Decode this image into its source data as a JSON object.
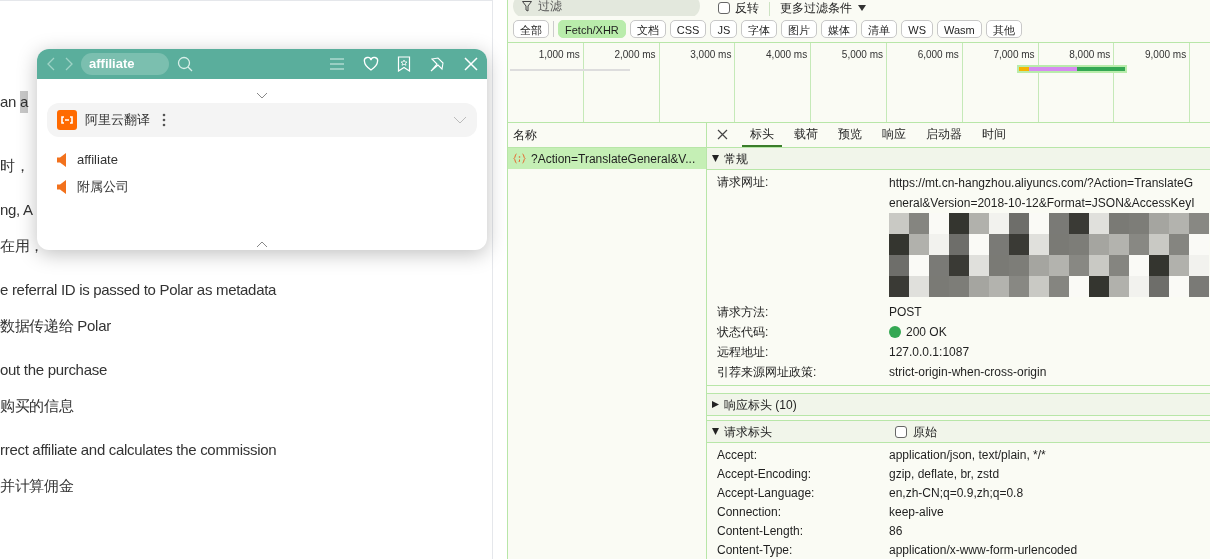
{
  "document": {
    "lines": [
      {
        "text": "an ",
        "selection": "a"
      },
      {
        "text": "时，"
      },
      {
        "text": "ng, A"
      },
      {
        "text": "在用，"
      },
      {
        "text": "e referral ID is passed to Polar as metadata"
      },
      {
        "text": "数据传递给 Polar"
      },
      {
        "text": "out the purchase"
      },
      {
        "text": "购买的信息"
      },
      {
        "text": "rrect affiliate and calculates the commission"
      },
      {
        "text": "并计算佣金"
      }
    ]
  },
  "popup": {
    "search": "affiliate",
    "engine": {
      "name": "阿里云翻译",
      "expanded": false
    },
    "results": [
      "affiliate",
      "附属公司"
    ]
  },
  "devtools": {
    "filter": {
      "placeholder": "过滤",
      "invert": {
        "label": "反转",
        "checked": false
      },
      "more": "更多过滤条件"
    },
    "type_filters": [
      {
        "label": "全部",
        "selected": false
      },
      {
        "label": "Fetch/XHR",
        "selected": true
      },
      {
        "label": "文档",
        "selected": false
      },
      {
        "label": "CSS",
        "selected": false
      },
      {
        "label": "JS",
        "selected": false
      },
      {
        "label": "字体",
        "selected": false
      },
      {
        "label": "图片",
        "selected": false
      },
      {
        "label": "媒体",
        "selected": false
      },
      {
        "label": "清单",
        "selected": false
      },
      {
        "label": "WS",
        "selected": false
      },
      {
        "label": "Wasm",
        "selected": false
      },
      {
        "label": "其他",
        "selected": false
      }
    ],
    "timeline": {
      "ticks": [
        "1,000 ms",
        "2,000 ms",
        "3,000 ms",
        "4,000 ms",
        "5,000 ms",
        "6,000 ms",
        "7,000 ms",
        "8,000 ms",
        "9,000 ms"
      ]
    },
    "requests": {
      "column": "名称",
      "rows": [
        {
          "name": "?Action=TranslateGeneral&V...",
          "selected": true
        }
      ]
    },
    "detail_tabs": [
      {
        "label": "标头",
        "selected": true
      },
      {
        "label": "载荷",
        "selected": false
      },
      {
        "label": "预览",
        "selected": false
      },
      {
        "label": "响应",
        "selected": false
      },
      {
        "label": "启动器",
        "selected": false
      },
      {
        "label": "时间",
        "selected": false
      }
    ],
    "general": {
      "title": "常规",
      "expanded": true,
      "rows": [
        {
          "kind": "url",
          "name": "请求网址:",
          "value_lines": [
            "https://mt.cn-hangzhou.aliyuncs.com/?Action=TranslateG",
            "eneral&Version=2018-10-12&Format=JSON&AccessKeyI"
          ]
        },
        {
          "kind": "plain",
          "name": "请求方法:",
          "value": "POST"
        },
        {
          "kind": "status",
          "name": "状态代码:",
          "value": "200 OK",
          "color": "#34a853"
        },
        {
          "kind": "plain",
          "name": "远程地址:",
          "value": "127.0.0.1:1087"
        },
        {
          "kind": "plain",
          "name": "引荐来源网址政策:",
          "value": "strict-origin-when-cross-origin"
        }
      ]
    },
    "response_headers": {
      "title": "响应标头 (10)",
      "expanded": false
    },
    "request_headers": {
      "title": "请求标头",
      "expanded": true,
      "raw": {
        "label": "原始",
        "checked": false
      },
      "rows": [
        {
          "name": "Accept:",
          "value": "application/json, text/plain, */*"
        },
        {
          "name": "Accept-Encoding:",
          "value": "gzip, deflate, br, zstd"
        },
        {
          "name": "Accept-Language:",
          "value": "en,zh-CN;q=0.9,zh;q=0.8"
        },
        {
          "name": "Connection:",
          "value": "keep-alive"
        },
        {
          "name": "Content-Length:",
          "value": "86"
        },
        {
          "name": "Content-Type:",
          "value": "application/x-www-form-urlencoded"
        }
      ]
    }
  }
}
